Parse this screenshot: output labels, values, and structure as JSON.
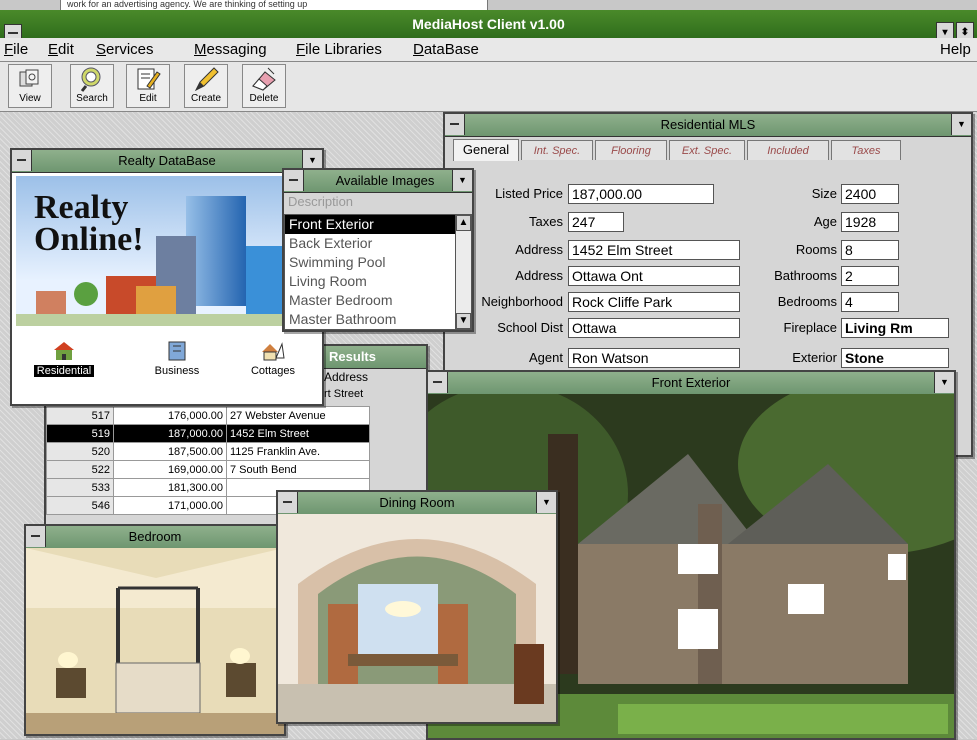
{
  "background_strip_text": "work for an advertising agency.  We are thinking of setting up",
  "app": {
    "title": "MediaHost Client v1.00",
    "help_label": "Help"
  },
  "menu": [
    {
      "label": "File",
      "ul": "F",
      "rest": "ile"
    },
    {
      "label": "Edit",
      "ul": "E",
      "rest": "dit"
    },
    {
      "label": "Services",
      "ul": "S",
      "rest": "ervices"
    },
    {
      "label": "Messaging",
      "ul": "M",
      "rest": "essaging"
    },
    {
      "label": "File Libraries",
      "ul": "F",
      "rest": "ile Libraries"
    },
    {
      "label": "DataBase",
      "ul": "D",
      "rest": "ataBase"
    }
  ],
  "toolbar": {
    "view": "View",
    "search": "Search",
    "edit": "Edit",
    "create": "Create",
    "delete": "Delete"
  },
  "realty_window": {
    "title": "Realty DataBase",
    "logo_line1": "Realty",
    "logo_line2": "Online!",
    "categories": [
      "Residential",
      "Business",
      "Cottages"
    ]
  },
  "images_window": {
    "title": "Available Images",
    "header": "Description",
    "items": [
      "Front Exterior",
      "Back Exterior",
      "Swimming Pool",
      "Living Room",
      "Master Bedroom",
      "Master Bathroom"
    ],
    "selected_index": 0
  },
  "mls_window": {
    "title": "Residential MLS",
    "tabs": [
      "General",
      "Int. Spec.",
      "Flooring",
      "Ext. Spec.",
      "Included",
      "Taxes"
    ],
    "left_fields": [
      {
        "label": "Listed Price",
        "value": "187,000.00"
      },
      {
        "label": "Taxes",
        "value": "247"
      },
      {
        "label": "Address",
        "value": "1452 Elm Street"
      },
      {
        "label": "Address",
        "value": "Ottawa Ont"
      },
      {
        "label": "Neighborhood",
        "value": "Rock Cliffe Park"
      },
      {
        "label": "School Dist",
        "value": "Ottawa"
      },
      {
        "label": "Agent",
        "value": "Ron Watson"
      }
    ],
    "right_fields": [
      {
        "label": "Size",
        "value": "2400"
      },
      {
        "label": "Age",
        "value": "1928"
      },
      {
        "label": "Rooms",
        "value": "8"
      },
      {
        "label": "Bathrooms",
        "value": "2"
      },
      {
        "label": "Bedrooms",
        "value": "4"
      },
      {
        "label": "Fireplace",
        "value": "Living Rm"
      },
      {
        "label": "Exterior",
        "value": "Stone"
      }
    ]
  },
  "results_window": {
    "title": "Results",
    "address_header": "Address",
    "first_partial": "rt Street",
    "rows": [
      {
        "id": "517",
        "price": "176,000.00",
        "address": "27 Webster Avenue"
      },
      {
        "id": "519",
        "price": "187,000.00",
        "address": "1452 Elm Street",
        "selected": true
      },
      {
        "id": "520",
        "price": "187,500.00",
        "address": "1125 Franklin Ave."
      },
      {
        "id": "522",
        "price": "169,000.00",
        "address": "7 South Bend"
      },
      {
        "id": "533",
        "price": "181,300.00",
        "address": ""
      },
      {
        "id": "546",
        "price": "171,000.00",
        "address": ""
      }
    ]
  },
  "photo_windows": {
    "front_exterior": "Front Exterior",
    "dining_room": "Dining Room",
    "bedroom": "Bedroom"
  }
}
